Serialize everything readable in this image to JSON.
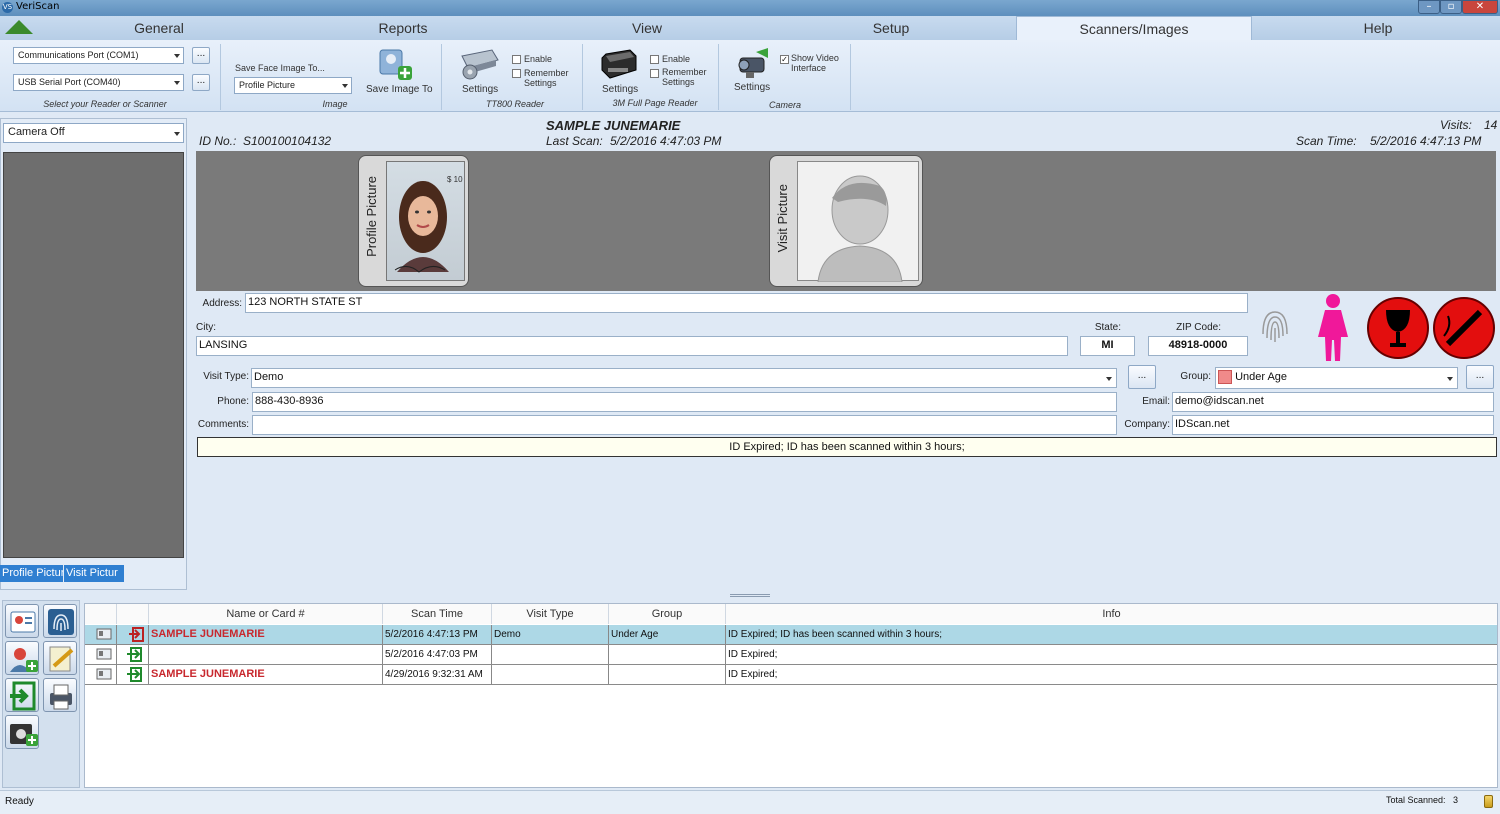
{
  "window": {
    "title": "VeriScan",
    "app_icon": "VS"
  },
  "tabs": [
    "General",
    "Reports",
    "View",
    "Setup",
    "Scanners/Images",
    "Help"
  ],
  "ribbon": {
    "reader": {
      "port1": "Communications Port (COM1)",
      "port2": "USB Serial Port (COM40)",
      "dots": "...",
      "group_label": "Select your Reader or Scanner"
    },
    "image": {
      "save_face_label": "Save Face Image To...",
      "save_face_value": "Profile Picture",
      "save_image_to": "Save Image To",
      "group_label": "Image"
    },
    "tt800": {
      "enable": "Enable",
      "remember": "Remember Settings",
      "settings": "Settings",
      "group_label": "TT800 Reader"
    },
    "m3": {
      "enable": "Enable",
      "remember": "Remember Settings",
      "settings": "Settings",
      "group_label": "3M Full Page Reader"
    },
    "camera": {
      "settings": "Settings",
      "show_video": "Show Video Interface",
      "show_video_checked": true,
      "group_label": "Camera"
    }
  },
  "left": {
    "camera_select": "Camera Off",
    "tab_profile": "Profile Pictur",
    "tab_visit": "Visit Pictur"
  },
  "record": {
    "name": "SAMPLE JUNEMARIE",
    "id_label": "ID No.:",
    "id_value": "S100100104132",
    "last_scan_label": "Last Scan:",
    "last_scan_value": "5/2/2016 4:47:03 PM",
    "visits_label": "Visits:",
    "visits_value": "14",
    "scan_time_label": "Scan Time:",
    "scan_time_value": "5/2/2016 4:47:13 PM",
    "profile_picture_label": "Profile Picture",
    "visit_picture_label": "Visit Picture",
    "address_label": "Address:",
    "address": "123 NORTH STATE ST",
    "city_label": "City:",
    "city": "LANSING",
    "state_label": "State:",
    "state": "MI",
    "zip_label": "ZIP Code:",
    "zip": "48918-0000",
    "visit_type_label": "Visit Type:",
    "visit_type": "Demo",
    "group_label": "Group:",
    "group": "Under Age",
    "group_color": "#f08a8a",
    "phone_label": "Phone:",
    "phone": "888-430-8936",
    "email_label": "Email:",
    "email": "demo@idscan.net",
    "comments_label": "Comments:",
    "comments": "",
    "company_label": "Company:",
    "company": "IDScan.net",
    "alert": "ID Expired; ID has been scanned within 3 hours;",
    "dots": "..."
  },
  "grid": {
    "headers": [
      "Name or Card #",
      "Scan Time",
      "Visit Type",
      "Group",
      "Info"
    ],
    "rows": [
      {
        "name": "SAMPLE JUNEMARIE",
        "scan_time": "5/2/2016 4:47:13 PM",
        "visit_type": "Demo",
        "group": "Under Age",
        "info": "ID Expired; ID has been scanned within 3 hours;",
        "icon": "exit-red-icon"
      },
      {
        "name": "",
        "scan_time": "5/2/2016 4:47:03 PM",
        "visit_type": "",
        "group": "",
        "info": "ID Expired;",
        "icon": "enter-green-icon"
      },
      {
        "name": "SAMPLE JUNEMARIE",
        "scan_time": "4/29/2016 9:32:31 AM",
        "visit_type": "",
        "group": "",
        "info": "ID Expired;",
        "icon": "enter-green-icon"
      }
    ]
  },
  "status": {
    "left": "Ready",
    "total_scanned_label": "Total Scanned:",
    "total_scanned": "3"
  }
}
